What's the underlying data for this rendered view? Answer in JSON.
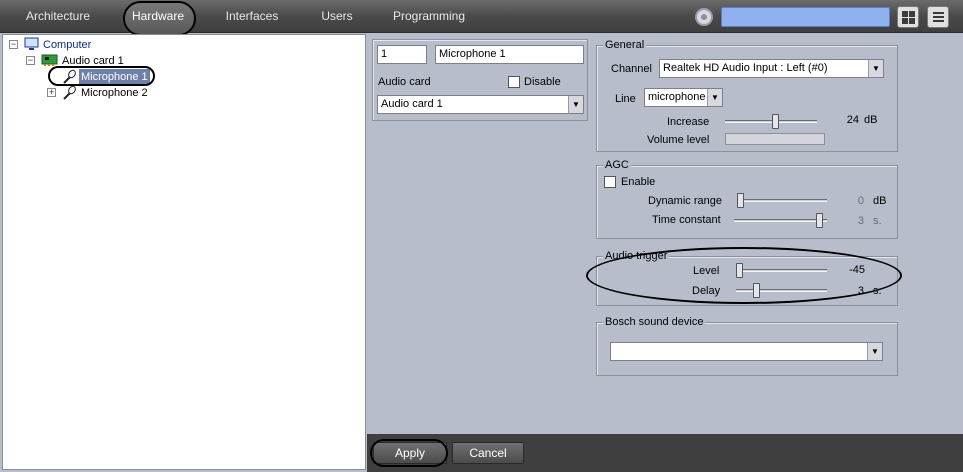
{
  "topbar": {
    "tabs": [
      {
        "label": "Architecture"
      },
      {
        "label": "Hardware"
      },
      {
        "label": "Interfaces"
      },
      {
        "label": "Users"
      },
      {
        "label": "Programming"
      }
    ],
    "active_tab": "Hardware",
    "search": {
      "value": ""
    }
  },
  "tree": {
    "nodes": [
      {
        "label": "Computer",
        "icon": "monitor-icon",
        "expanded": true
      },
      {
        "label": "Audio card 1",
        "icon": "audio-card-icon",
        "expanded": true
      },
      {
        "label": "Microphone 1",
        "icon": "microphone-icon",
        "selected": true
      },
      {
        "label": "Microphone 2",
        "icon": "microphone-icon",
        "expanded": false
      }
    ]
  },
  "device": {
    "id": "1",
    "name": "Microphone 1",
    "audio_card_label": "Audio card",
    "disable_label": "Disable",
    "disable_checked": false,
    "audio_card_value": "Audio card 1"
  },
  "general": {
    "title": "General",
    "channel_label": "Channel",
    "channel_value": "Realtek HD Audio Input : Left (#0)",
    "line_label": "Line",
    "line_value": "microphone",
    "increase_label": "Increase",
    "increase_value": "24",
    "increase_unit": "dB",
    "increase_fraction": 0.55,
    "volume_label": "Volume level",
    "volume_fraction": 0.0
  },
  "agc": {
    "title": "AGC",
    "enable_label": "Enable",
    "enable_checked": false,
    "dynamic_range_label": "Dynamic range",
    "dynamic_range_value": "0",
    "dynamic_range_unit": "dB",
    "dynamic_range_fraction": 0.0,
    "time_constant_label": "Time constant",
    "time_constant_value": "3",
    "time_constant_unit": "s.",
    "time_constant_fraction": 0.95
  },
  "audio_trigger": {
    "title": "Audio trigger",
    "level_label": "Level",
    "level_value": "-45",
    "level_fraction": 0.0,
    "delay_label": "Delay",
    "delay_value": "3",
    "delay_unit": "s.",
    "delay_fraction": 0.2
  },
  "bosch": {
    "title": "Bosch sound device",
    "value": ""
  },
  "buttons": {
    "apply": "Apply",
    "cancel": "Cancel"
  },
  "colors": {
    "topbar": "#4a4a4a",
    "panel": "#b8bdcc",
    "search": "#8fb1f0",
    "selection": "#6e7fa8"
  }
}
